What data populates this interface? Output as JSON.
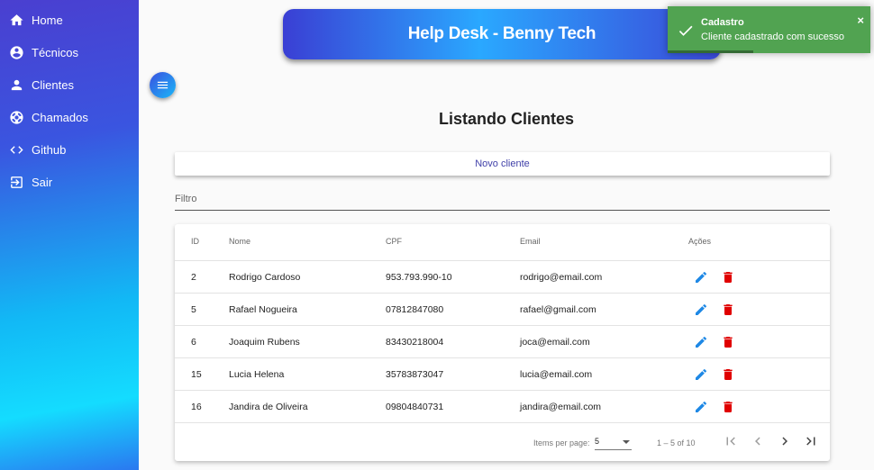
{
  "sidebar": {
    "items": [
      {
        "label": "Home",
        "icon": "home-icon"
      },
      {
        "label": "Técnicos",
        "icon": "account-circle-icon"
      },
      {
        "label": "Clientes",
        "icon": "person-icon"
      },
      {
        "label": "Chamados",
        "icon": "lifebuoy-icon"
      },
      {
        "label": "Github",
        "icon": "code-icon"
      },
      {
        "label": "Sair",
        "icon": "logout-icon"
      }
    ]
  },
  "header": {
    "title": "Help Desk - Benny Tech"
  },
  "toast": {
    "title": "Cadastro",
    "message": "Cliente cadastrado com sucesso",
    "close": "×",
    "color": "#51a351"
  },
  "main": {
    "title": "Listando Clientes",
    "new_button": "Novo cliente",
    "filter_placeholder": "Filtro"
  },
  "table": {
    "columns": [
      "ID",
      "Nome",
      "CPF",
      "Email",
      "Ações"
    ],
    "rows": [
      {
        "id": "2",
        "nome": "Rodrigo Cardoso",
        "cpf": "953.793.990-10",
        "email": "rodrigo@email.com"
      },
      {
        "id": "5",
        "nome": "Rafael Nogueira",
        "cpf": "07812847080",
        "email": "rafael@gmail.com"
      },
      {
        "id": "6",
        "nome": "Joaquim Rubens",
        "cpf": "83430218004",
        "email": "joca@email.com"
      },
      {
        "id": "15",
        "nome": "Lucia Helena",
        "cpf": "35783873047",
        "email": "lucia@email.com"
      },
      {
        "id": "16",
        "nome": "Jandira de Oliveira",
        "cpf": "09804840731",
        "email": "jandira@email.com"
      }
    ]
  },
  "paginator": {
    "items_per_page_label": "Items per page:",
    "page_size": "5",
    "range": "1 – 5 of 10"
  },
  "colors": {
    "edit": "#1e88e5",
    "delete": "#e00000",
    "accent": "#3f3fa8"
  }
}
